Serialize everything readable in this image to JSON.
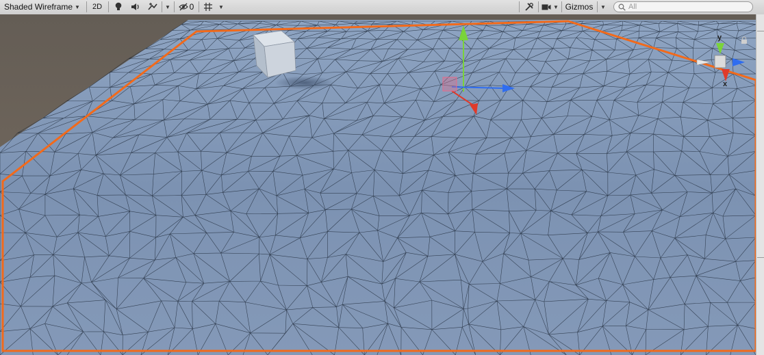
{
  "toolbar": {
    "draw_mode": "Shaded Wireframe",
    "mode_2d": "2D",
    "hidden_count": "0",
    "gizmos_label": "Gizmos",
    "search_placeholder": "All"
  },
  "icons": {
    "lighting": "lightbulb-icon",
    "audio": "audio-icon",
    "effects": "effects-icon",
    "visibility": "eye-hidden-icon",
    "grid": "grid-icon",
    "tools": "tools-icon",
    "camera": "camera-icon",
    "search": "search-icon",
    "lock": "lock-icon"
  },
  "scene_gizmo": {
    "axes": [
      "y",
      "x"
    ]
  },
  "colors": {
    "selection_outline": "#f26a1b",
    "terrain": "#7f96b6",
    "background": "#686058",
    "axis_x": "#e03a2a",
    "axis_y": "#7ad33a",
    "axis_z": "#2f6df0"
  }
}
